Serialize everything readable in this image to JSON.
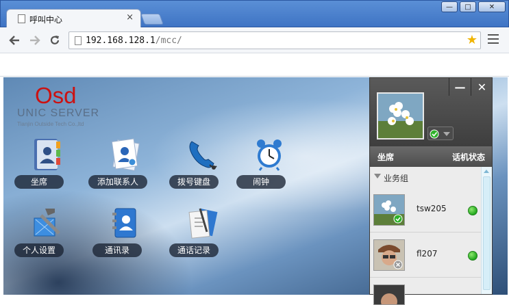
{
  "browser": {
    "tab_title": "呼叫中心",
    "tab_close": "×",
    "url_host": "192.168.128.1",
    "url_path": "/mcc/",
    "window_controls": [
      "—",
      "□",
      "✕"
    ]
  },
  "logo": {
    "brand": "Osd",
    "product": "UNIC SERVER",
    "company": "Tianjin Outside Tech Co.,ltd"
  },
  "apps": [
    {
      "label": "坐席",
      "icon": "address-book-icon"
    },
    {
      "label": "添加联系人",
      "icon": "add-contact-icon"
    },
    {
      "label": "拨号键盘",
      "icon": "phone-handset-icon"
    },
    {
      "label": "闹钟",
      "icon": "alarm-clock-icon"
    },
    {
      "label": "个人设置",
      "icon": "settings-tools-icon"
    },
    {
      "label": "通讯录",
      "icon": "contacts-book-icon"
    },
    {
      "label": "通话记录",
      "icon": "call-log-icon"
    }
  ],
  "panel": {
    "minimize": "—",
    "close": "✕",
    "tabs": {
      "seat": "坐席",
      "phone_status": "话机状态"
    },
    "group_name": "业务组",
    "users": [
      {
        "name": "tsw205",
        "status": "online",
        "status_color": "#2fb22a"
      },
      {
        "name": "fl207",
        "status": "online",
        "status_color": "#2fb22a"
      }
    ]
  }
}
